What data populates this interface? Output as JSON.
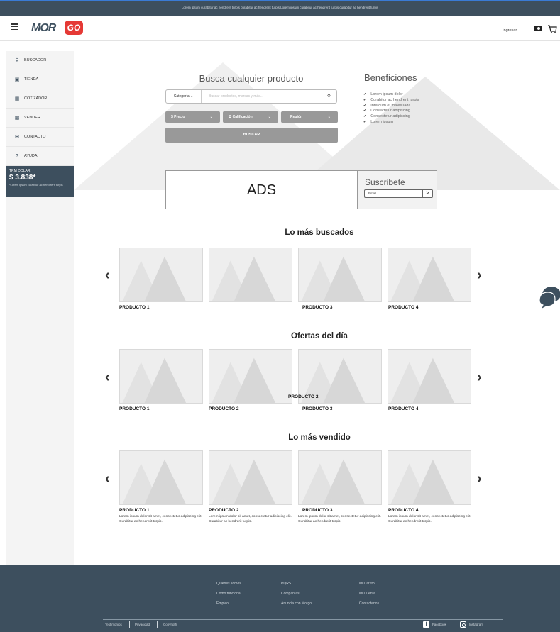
{
  "topbar": {
    "text": "Lorem ipsum curabitur ac hendrerit turpis curabitur ac hendrerit turpis   Lorem ipsum curabitur ac hendrerit turpis curabitur ac hendrerit turpis"
  },
  "header": {
    "logo_left": "MOR",
    "logo_right": "GO",
    "login_label": "Ingresar"
  },
  "sidebar": {
    "items": [
      {
        "label": "BUSCADOR",
        "icon": "search-icon"
      },
      {
        "label": "TIENDA",
        "icon": "store-icon"
      },
      {
        "label": "COTIZADOR",
        "icon": "calculator-icon"
      },
      {
        "label": "VENDER",
        "icon": "money-icon"
      },
      {
        "label": "CONTACTO",
        "icon": "mail-icon"
      },
      {
        "label": "AYUDA",
        "icon": "help-icon"
      }
    ],
    "trm": {
      "label": "TRM DOLAR",
      "value": "$ 3.838*",
      "note": "*Lorem ipsum curabitur ac hend rerit turpis"
    }
  },
  "search": {
    "title": "Busca cualquier producto",
    "category_label": "Categoría ⌄",
    "placeholder": "Buscar productos, marcas y más...",
    "filters": [
      "$ Precio",
      "✪ Calificación",
      "Región"
    ],
    "button": "BUSCAR"
  },
  "benefits": {
    "title": "Beneficiones",
    "items": [
      "Lorem ipsum dolor",
      "Curabitur ac hendrerit turpis",
      "Interdum et malesuada",
      "Consectetur adipiscing",
      "Consectetur adipiscing",
      "Lorem ipsum"
    ]
  },
  "ads": {
    "label": "ADS"
  },
  "subscribe": {
    "title": "Suscribete",
    "email_placeholder": "Email",
    "submit": ">"
  },
  "sections": [
    {
      "title": "Lo más buscados",
      "products": [
        "PRODUCTO 1",
        "",
        "PRODUCTO 3",
        "PRODUCTO 4"
      ]
    },
    {
      "title": "Ofertas del día",
      "products": [
        "PRODUCTO 1",
        "PRODUCTO 2",
        "PRODUCTO 3",
        "PRODUCTO 4"
      ],
      "overlay_label": "PRODUCTO 2"
    },
    {
      "title": "Lo más vendido",
      "products": [
        "PRODUCTO 1",
        "PRODUCTO 2",
        "PRODUCTO 3",
        "PRODUCTO 4"
      ],
      "description": "Lorem ipsum dolor sit amet, consectetur adipiscing elit. Curabitur ac hendrerit turpis."
    }
  ],
  "arrows": {
    "prev": "‹",
    "next": "›"
  },
  "footer": {
    "col1": [
      "Quienes somos",
      "Como funciona",
      "Empleo"
    ],
    "col2": [
      "PQRS",
      "Compañías",
      "Anuncia con Morgo"
    ],
    "col3": [
      "Mi Carrito",
      "Mi Cuenta",
      "Contactenos"
    ],
    "bottom": [
      "Testimonios",
      "Privacidad",
      "Copyrigth"
    ],
    "social": [
      "Facebook",
      "Instagram"
    ]
  }
}
